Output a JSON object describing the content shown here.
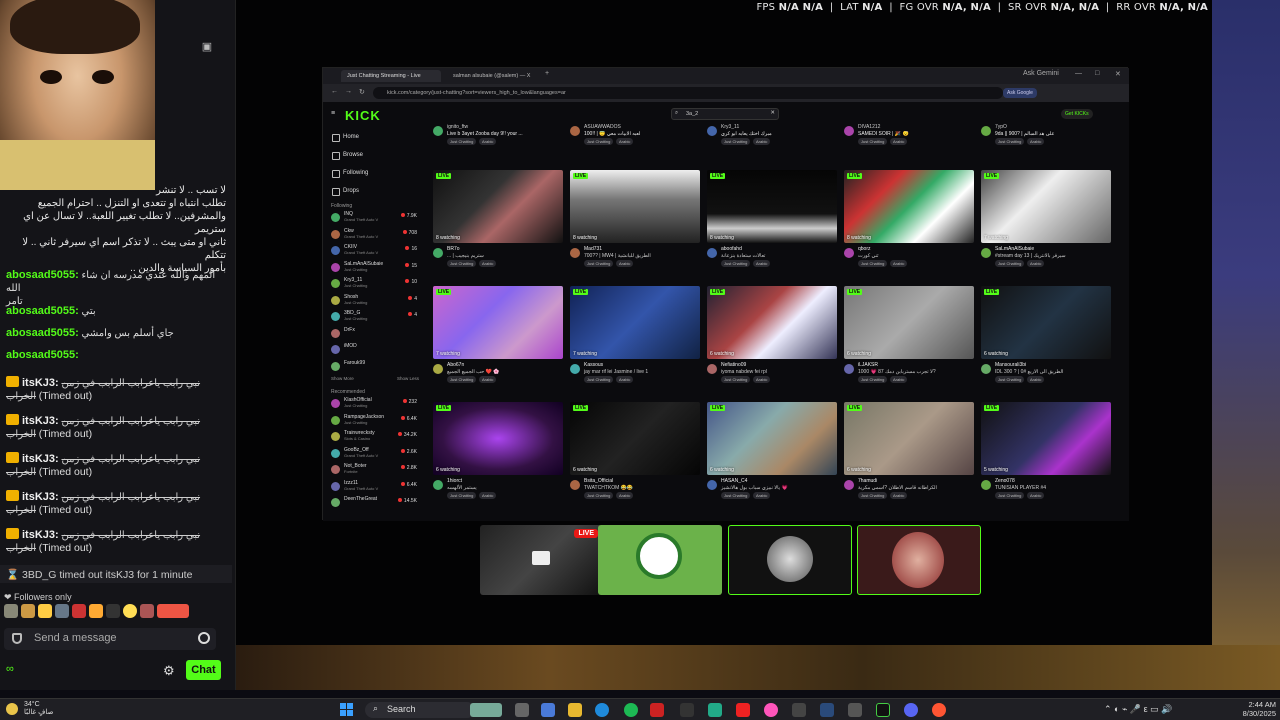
{
  "perf": {
    "fps_label": "FPS",
    "fps_value": "N/A N/A",
    "lat_label": "LAT",
    "lat_value": "N/A",
    "fg_label": "FG OVR",
    "fg_value": "N/A, N/A",
    "sr_label": "SR OVR",
    "sr_value": "N/A, N/A",
    "rr_label": "RR OVR",
    "rr_value": "N/A, N/A"
  },
  "chat": {
    "arabic_lines": [
      "لا تسب .. لا تنشر",
      "تطلب انتباه او تتعدى او التنزل .. احترام الجميع",
      "والمشرفين.. لا تطلب تغيير اللعبة.. لا تسال عن اي ستريمر",
      "ثاني او متى يبث .. لا تذكر اسم اي سيرفر ثاني .. لا تتكلم",
      "بأمور السياسة والدين .."
    ],
    "messages": [
      {
        "user": "abosaad5055:",
        "text": "المهم والله عندي مدرسه ان شاء الله",
        "text2": "تامر"
      },
      {
        "user": "abosaad5055:",
        "text": "بتي"
      },
      {
        "user": "abosaad5055:",
        "text": "جاي أسلم بس وامشي"
      },
      {
        "user": "abosaad5055:",
        "text": ""
      }
    ],
    "timed": [
      {
        "user": "itsKJ3:",
        "text": "نبي رابب ياعرابب الرابب في زمن",
        "text2": "الخراب",
        "status": "(Timed out)"
      },
      {
        "user": "itsKJ3:",
        "text": "نبي رابب ياعرابب الرابب في زمن",
        "text2": "الخراب",
        "status": "(Timed out)"
      },
      {
        "user": "itsKJ3:",
        "text": "نبي رابب ياعرابب الرابب في زمن",
        "text2": "الخراب",
        "status": "(Timed out)"
      },
      {
        "user": "itsKJ3:",
        "text": "نبي رابب ياعرابب الرابب في زمن",
        "text2": "الخراب",
        "status": "(Timed out)"
      },
      {
        "user": "itsKJ3:",
        "text": "نبي رابب ياعرابب الرابب في زمن",
        "text2": "الخراب",
        "status": "(Timed out)"
      }
    ],
    "system_msg": "3BD_G timed out itsKJ3 for 1 minute",
    "followers_only": "Followers only",
    "send_placeholder": "Send a message",
    "chat_button": "Chat",
    "oo_label": "∞"
  },
  "browser": {
    "tab1": "Just Chatting Streaming - Live",
    "tab2": "salman alsubaie (@salem) — X",
    "ask_gemini": "Ask Gemini",
    "url": "kick.com/category/just-chatting?sort=viewers_high_to_low&languages=ar",
    "ask_google": "Ask Google"
  },
  "kick": {
    "logo": "KICK",
    "search_value": "3a_2",
    "get_kicks": "Get KICKs",
    "nav": [
      "Home",
      "Browse",
      "Following",
      "Drops"
    ],
    "following_label": "Following",
    "following": [
      {
        "name": "INQ",
        "game": "Grand Theft Auto V",
        "count": "7.9K"
      },
      {
        "name": "Ckw",
        "game": "Grand Theft Auto V",
        "count": "708"
      },
      {
        "name": "CKIIV",
        "game": "Grand Theft Auto V",
        "count": "16"
      },
      {
        "name": "SaLmAnAlSubaie",
        "game": "Just Chatting",
        "count": "15"
      },
      {
        "name": "Kry3_11",
        "game": "Just Chatting",
        "count": "10"
      },
      {
        "name": "Shosh",
        "game": "Just Chatting",
        "count": "4"
      },
      {
        "name": "3BD_G",
        "game": "Just Chatting",
        "count": "4"
      },
      {
        "name": "DrFx",
        "game": "",
        "count": ""
      },
      {
        "name": "iMOD",
        "game": "",
        "count": ""
      },
      {
        "name": "Farouk99",
        "game": "",
        "count": ""
      }
    ],
    "show_more": "Show More",
    "show_less": "Show Less",
    "recommended_label": "Recommended",
    "recommended": [
      {
        "name": "KlashOfficial",
        "game": "Just Chatting",
        "count": "232"
      },
      {
        "name": "RampageJackson",
        "game": "Just Chatting",
        "count": "6.4K"
      },
      {
        "name": "Trainwrecksty",
        "game": "Slots & Casino",
        "count": "34.2K"
      },
      {
        "name": "GooBz_Off",
        "game": "Grand Theft Auto V",
        "count": "2.6K"
      },
      {
        "name": "Not_Boter",
        "game": "Fortnite",
        "count": "2.8K"
      },
      {
        "name": "Izzz11",
        "game": "Grand Theft Auto V",
        "count": "6.4K"
      },
      {
        "name": "DeenTheGreat",
        "game": "",
        "count": "14.5K"
      }
    ],
    "top_row": [
      {
        "name": "ignito_ftw",
        "title": "Live b 3ayet Zooba day 9!! your ..."
      },
      {
        "name": "ASUAWWADOS",
        "title": "100!! | 😇 لعبه الابيات معي"
      },
      {
        "name": "Kry3_11",
        "title": "مبرك اختك يعابه ابو كري"
      },
      {
        "name": "DIVA1212",
        "title": "SAMEDI SOIR | 🎉 😴"
      },
      {
        "name": "7ypO",
        "title": "9da || 900? | على هد السالم"
      }
    ],
    "rows": [
      [
        {
          "watching": "8 watching",
          "name": "BR7o",
          "title": "... | ستريم بنيجيب"
        },
        {
          "watching": "8 watching",
          "name": "Mad731",
          "title": "700?? | MW4 | الطريق للبانشية"
        },
        {
          "watching": "8 watching",
          "name": "aboofahd",
          "title": "تعالات ستعادة بنزعانة"
        },
        {
          "watching": "8 watching",
          "name": "qborz",
          "title": "ثني كورت"
        },
        {
          "watching": "7 watching",
          "name": "SaLmAnAlSubaie",
          "title": "#stream day 13 | سيرفر بالانتريك"
        }
      ],
      [
        {
          "watching": "7 watching",
          "name": "Abo67n",
          "title": "حب الجميع الجميع ❤️ 🌸"
        },
        {
          "watching": "7 watching",
          "name": "Kassous",
          "title": "jay mar rif lei Jasmine / live 1"
        },
        {
          "watching": "6 watching",
          "name": "Nefiatino09",
          "title": "iyoma nabdew fei rpl"
        },
        {
          "watching": "6 watching",
          "name": "iLJAKSR",
          "title": "لا تجرب مستربابن دمك 87 💗 1000?"
        },
        {
          "watching": "6 watching",
          "name": "Mansourali3bi",
          "title": "IDL 300 ? | 0# الطريق الى الاربع"
        }
      ],
      [
        {
          "watching": "6 watching",
          "name": "1hiorct",
          "title": "يستمر الألهسه"
        },
        {
          "watching": "6 watching",
          "name": "Bsita_Official",
          "title": "TWATCHTKOM 😂😂"
        },
        {
          "watching": "6 watching",
          "name": "HASAN_C4",
          "title": "يالا نبيزي سباب بول هالانشيز 💗"
        },
        {
          "watching": "6 watching",
          "name": "7hamudi",
          "title": "الكراطانه قاسم الاطلان ?اسمي مكرية"
        },
        {
          "watching": "5 watching",
          "name": "Zeno078",
          "title": "TUNISIAN PLAYER #4"
        }
      ]
    ],
    "tag_chat": "Just Chatting",
    "tag_ar": "Arabic",
    "live_label": "LIVE"
  },
  "tiles": {
    "live_label": "LIVE"
  },
  "taskbar": {
    "temp": "34°C",
    "weather_text": "صافٍ غالبًا",
    "search": "Search",
    "time": "2:44 AM",
    "date": "8/30/2025"
  },
  "colors": {
    "kick_green": "#53fc18",
    "live_red": "#e91916"
  }
}
